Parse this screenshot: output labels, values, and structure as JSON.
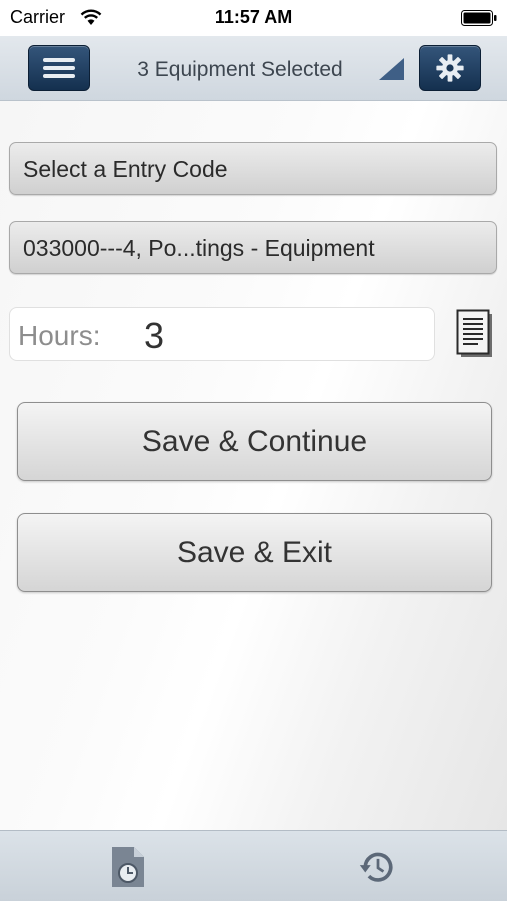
{
  "status_bar": {
    "carrier": "Carrier",
    "time": "11:57 AM"
  },
  "nav": {
    "title": "3 Equipment Selected",
    "menu_icon": "hamburger-menu-icon",
    "settings_icon": "gear-icon",
    "accent_color": "#1f3b5c"
  },
  "form": {
    "entry_code_button": "Select a Entry Code",
    "cost_code_button": "033000---4, Po...tings - Equipment",
    "hours_label": "Hours:",
    "hours_value": "3",
    "notes_icon": "document-icon"
  },
  "actions": {
    "save_continue": "Save & Continue",
    "save_exit": "Save & Exit"
  },
  "tab_bar": {
    "items": [
      {
        "icon": "timesheet-clock-icon"
      },
      {
        "icon": "history-icon"
      }
    ]
  }
}
